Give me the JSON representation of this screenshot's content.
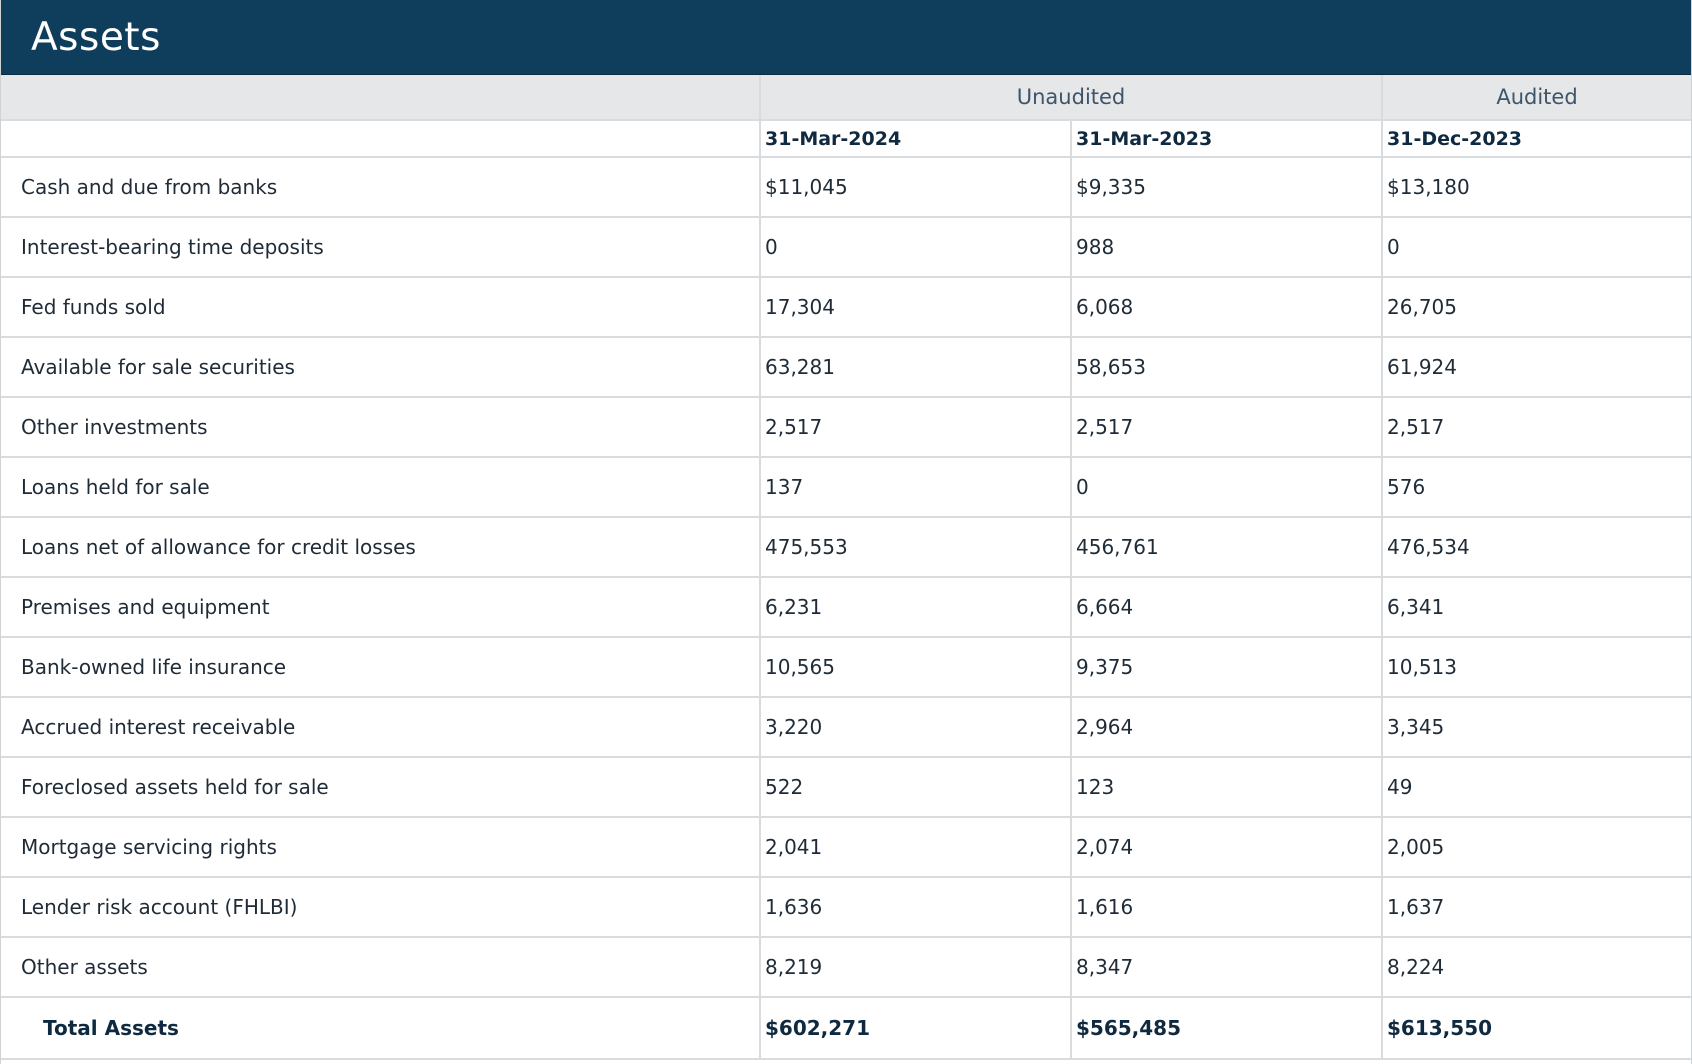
{
  "header": {
    "title": "Assets"
  },
  "columns": {
    "groups": {
      "unaudited": "Unaudited",
      "audited": "Audited"
    },
    "dates": [
      "31-Mar-2024",
      "31-Mar-2023",
      "31-Dec-2023"
    ]
  },
  "rows": [
    {
      "label": "Cash and due from banks",
      "values": [
        "$11,045",
        "$9,335",
        "$13,180"
      ]
    },
    {
      "label": "Interest-bearing time deposits",
      "values": [
        "0",
        "988",
        "0"
      ]
    },
    {
      "label": "Fed funds sold",
      "values": [
        "17,304",
        "6,068",
        "26,705"
      ]
    },
    {
      "label": "Available for sale securities",
      "values": [
        "63,281",
        "58,653",
        "61,924"
      ]
    },
    {
      "label": "Other investments",
      "values": [
        "2,517",
        "2,517",
        "2,517"
      ]
    },
    {
      "label": "Loans held for sale",
      "values": [
        "137",
        "0",
        "576"
      ]
    },
    {
      "label": "Loans net of allowance for credit losses",
      "values": [
        "475,553",
        "456,761",
        "476,534"
      ]
    },
    {
      "label": "Premises and equipment",
      "values": [
        "6,231",
        "6,664",
        "6,341"
      ]
    },
    {
      "label": "Bank-owned life insurance",
      "values": [
        "10,565",
        "9,375",
        "10,513"
      ]
    },
    {
      "label": "Accrued interest receivable",
      "values": [
        "3,220",
        "2,964",
        "3,345"
      ]
    },
    {
      "label": "Foreclosed assets held for sale",
      "values": [
        "522",
        "123",
        "49"
      ]
    },
    {
      "label": "Mortgage servicing rights",
      "values": [
        "2,041",
        "2,074",
        "2,005"
      ]
    },
    {
      "label": "Lender risk account (FHLBI)",
      "values": [
        "1,636",
        "1,616",
        "1,637"
      ]
    },
    {
      "label": "Other assets",
      "values": [
        "8,219",
        "8,347",
        "8,224"
      ]
    }
  ],
  "total": {
    "label": "Total Assets",
    "values": [
      "$602,271",
      "$565,485",
      "$613,550"
    ]
  }
}
